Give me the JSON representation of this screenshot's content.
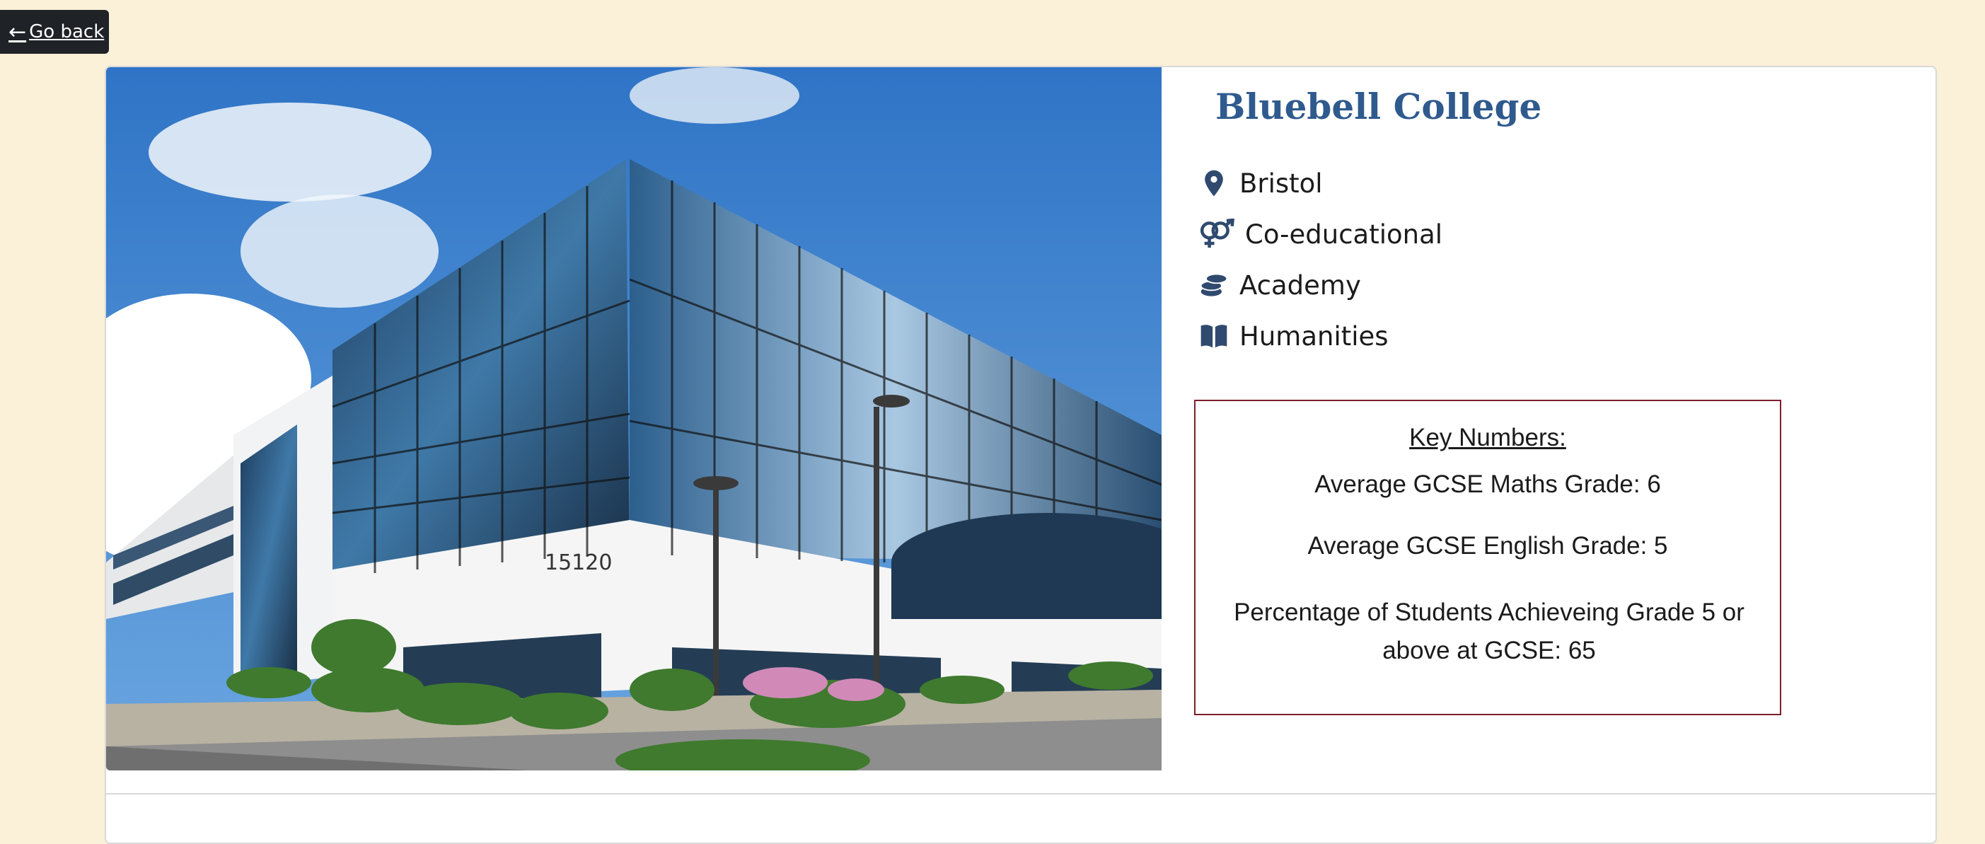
{
  "nav": {
    "back_label": "Go back",
    "back_icon": "arrow-left-icon"
  },
  "school": {
    "name": "Bluebell College",
    "photo_building_number": "15120",
    "details": [
      {
        "icon": "map-marker-icon",
        "label": "Bristol"
      },
      {
        "icon": "venus-mars-icon",
        "label": "Co-educational"
      },
      {
        "icon": "coins-icon",
        "label": "Academy"
      },
      {
        "icon": "open-book-icon",
        "label": "Humanities"
      }
    ]
  },
  "key_numbers": {
    "heading": "Key Numbers:",
    "maths": "Average GCSE Maths Grade: 6",
    "english": "Average GCSE English Grade: 5",
    "percentage": "Percentage of Students Achieveing Grade 5 or above at GCSE: 65"
  },
  "colors": {
    "background": "#fbf0d8",
    "title": "#2f5a8e",
    "icon": "#2f4a6e",
    "key_box_border": "#7d1f2c",
    "back_button": "#1f2226"
  }
}
